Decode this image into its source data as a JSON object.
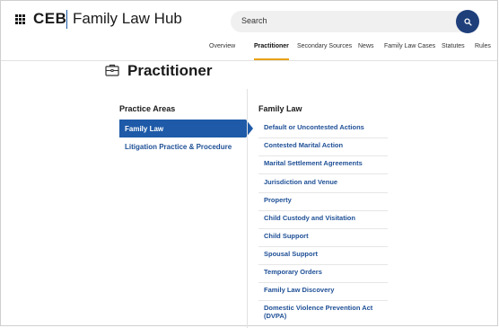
{
  "header": {
    "brand": "CEB",
    "product": "Family Law Hub",
    "search_placeholder": "Search"
  },
  "nav": {
    "items": [
      {
        "label": "Overview",
        "active": false
      },
      {
        "label": "Practitioner",
        "active": true
      },
      {
        "label": "Secondary Sources",
        "active": false
      },
      {
        "label": "News",
        "active": false
      },
      {
        "label": "Family Law Cases",
        "active": false
      },
      {
        "label": "Statutes",
        "active": false
      },
      {
        "label": "Rules",
        "active": false
      }
    ]
  },
  "page": {
    "title": "Practitioner",
    "title_icon": "briefcase-icon"
  },
  "practice_areas": {
    "heading": "Practice Areas",
    "items": [
      {
        "label": "Family Law",
        "active": true
      },
      {
        "label": "Litigation Practice & Procedure",
        "active": false
      }
    ]
  },
  "family_law": {
    "heading": "Family Law",
    "items": [
      "Default or Uncontested Actions",
      "Contested Marital Action",
      "Marital Settlement Agreements",
      "Jurisdiction and Venue",
      "Property",
      "Child Custody and Visitation",
      "Child Support",
      "Spousal Support",
      "Temporary Orders",
      "Family Law Discovery",
      "Domestic Violence Prevention Act (DVPA)"
    ]
  },
  "colors": {
    "accent": "#1e5aa8",
    "link": "#1e4f96",
    "active_underline": "#e8a317",
    "search_button": "#1e3f7a"
  }
}
